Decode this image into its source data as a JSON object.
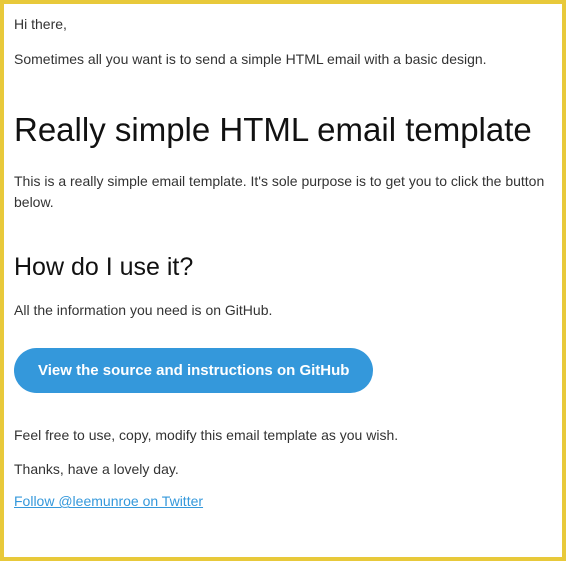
{
  "greeting": "Hi there,",
  "intro": "Sometimes all you want is to send a simple HTML email with a basic design.",
  "main_heading": "Really simple HTML email template",
  "description": "This is a really simple email template. It's sole purpose is to get you to click the button below.",
  "sub_heading": "How do I use it?",
  "sub_text": "All the information you need is on GitHub.",
  "cta_label": "View the source and instructions on GitHub",
  "closing_1": "Feel free to use, copy, modify this email template as you wish.",
  "closing_2": "Thanks, have a lovely day.",
  "twitter_link": "Follow @leemunroe on Twitter"
}
